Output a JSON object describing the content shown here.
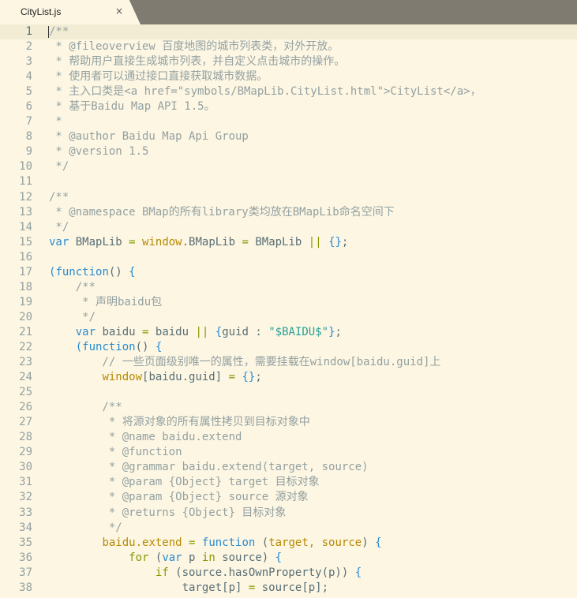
{
  "tab": {
    "title": "CityList.js",
    "close_glyph": "×"
  },
  "colors": {
    "background": "#fdf6e3",
    "comment": "#93a1a1",
    "keyword": "#268bd2",
    "global": "#b58900",
    "string": "#2aa198",
    "operator": "#859900",
    "text": "#586e75"
  },
  "editor": {
    "current_line": 1,
    "lines": [
      {
        "n": "1",
        "tokens": [
          {
            "t": "/**",
            "c": "comment"
          }
        ]
      },
      {
        "n": "2",
        "tokens": [
          {
            "t": " * @fileoverview 百度地图的城市列表类，对外开放。",
            "c": "comment"
          }
        ]
      },
      {
        "n": "3",
        "tokens": [
          {
            "t": " * 帮助用户直接生成城市列表，并自定义点击城市的操作。",
            "c": "comment"
          }
        ]
      },
      {
        "n": "4",
        "tokens": [
          {
            "t": " * 使用者可以通过接口直接获取城市数据。",
            "c": "comment"
          }
        ]
      },
      {
        "n": "5",
        "tokens": [
          {
            "t": " * 主入口类是<a href=\"symbols/BMapLib.CityList.html\">CityList</a>，",
            "c": "comment"
          }
        ]
      },
      {
        "n": "6",
        "tokens": [
          {
            "t": " * 基于Baidu Map API 1.5。",
            "c": "comment"
          }
        ]
      },
      {
        "n": "7",
        "tokens": [
          {
            "t": " *",
            "c": "comment"
          }
        ]
      },
      {
        "n": "8",
        "tokens": [
          {
            "t": " * @author Baidu Map Api Group",
            "c": "comment"
          }
        ]
      },
      {
        "n": "9",
        "tokens": [
          {
            "t": " * @version 1.5",
            "c": "comment"
          }
        ]
      },
      {
        "n": "10",
        "tokens": [
          {
            "t": " */",
            "c": "comment"
          }
        ]
      },
      {
        "n": "11",
        "tokens": []
      },
      {
        "n": "12",
        "tokens": [
          {
            "t": "/**",
            "c": "comment"
          }
        ]
      },
      {
        "n": "13",
        "tokens": [
          {
            "t": " * @namespace BMap的所有library类均放在BMapLib命名空间下",
            "c": "comment"
          }
        ]
      },
      {
        "n": "14",
        "tokens": [
          {
            "t": " */",
            "c": "comment"
          }
        ]
      },
      {
        "n": "15",
        "tokens": [
          {
            "t": "var",
            "c": "kw"
          },
          {
            "t": " BMapLib ",
            "c": "plain"
          },
          {
            "t": "=",
            "c": "op"
          },
          {
            "t": " ",
            "c": "plain"
          },
          {
            "t": "window",
            "c": "glob"
          },
          {
            "t": ".BMapLib ",
            "c": "plain"
          },
          {
            "t": "=",
            "c": "op"
          },
          {
            "t": " BMapLib ",
            "c": "plain"
          },
          {
            "t": "||",
            "c": "op"
          },
          {
            "t": " ",
            "c": "plain"
          },
          {
            "t": "{}",
            "c": "kw"
          },
          {
            "t": ";",
            "c": "plain"
          }
        ]
      },
      {
        "n": "16",
        "tokens": []
      },
      {
        "n": "17",
        "tokens": [
          {
            "t": "(",
            "c": "kw"
          },
          {
            "t": "function",
            "c": "kw"
          },
          {
            "t": "() ",
            "c": "plain"
          },
          {
            "t": "{",
            "c": "kw"
          }
        ]
      },
      {
        "n": "18",
        "tokens": [
          {
            "t": "    /**",
            "c": "comment"
          }
        ]
      },
      {
        "n": "19",
        "tokens": [
          {
            "t": "     * 声明baidu包",
            "c": "comment"
          }
        ]
      },
      {
        "n": "20",
        "tokens": [
          {
            "t": "     */",
            "c": "comment"
          }
        ]
      },
      {
        "n": "21",
        "tokens": [
          {
            "t": "    ",
            "c": "plain"
          },
          {
            "t": "var",
            "c": "kw"
          },
          {
            "t": " baidu ",
            "c": "plain"
          },
          {
            "t": "=",
            "c": "op"
          },
          {
            "t": " baidu ",
            "c": "plain"
          },
          {
            "t": "||",
            "c": "op"
          },
          {
            "t": " ",
            "c": "plain"
          },
          {
            "t": "{",
            "c": "kw"
          },
          {
            "t": "guid : ",
            "c": "plain"
          },
          {
            "t": "\"$BAIDU$\"",
            "c": "str"
          },
          {
            "t": "}",
            "c": "kw"
          },
          {
            "t": ";",
            "c": "plain"
          }
        ]
      },
      {
        "n": "22",
        "tokens": [
          {
            "t": "    ",
            "c": "plain"
          },
          {
            "t": "(",
            "c": "kw"
          },
          {
            "t": "function",
            "c": "kw"
          },
          {
            "t": "() ",
            "c": "plain"
          },
          {
            "t": "{",
            "c": "kw"
          }
        ]
      },
      {
        "n": "23",
        "tokens": [
          {
            "t": "        // 一些页面级别唯一的属性，需要挂载在window[baidu.guid]上",
            "c": "comment"
          }
        ]
      },
      {
        "n": "24",
        "tokens": [
          {
            "t": "        ",
            "c": "plain"
          },
          {
            "t": "window",
            "c": "glob"
          },
          {
            "t": "[baidu.guid] ",
            "c": "plain"
          },
          {
            "t": "=",
            "c": "op"
          },
          {
            "t": " ",
            "c": "plain"
          },
          {
            "t": "{}",
            "c": "kw"
          },
          {
            "t": ";",
            "c": "plain"
          }
        ]
      },
      {
        "n": "25",
        "tokens": []
      },
      {
        "n": "26",
        "tokens": [
          {
            "t": "        /**",
            "c": "comment"
          }
        ]
      },
      {
        "n": "27",
        "tokens": [
          {
            "t": "         * 将源对象的所有属性拷贝到目标对象中",
            "c": "comment"
          }
        ]
      },
      {
        "n": "28",
        "tokens": [
          {
            "t": "         * @name baidu.extend",
            "c": "comment"
          }
        ]
      },
      {
        "n": "29",
        "tokens": [
          {
            "t": "         * @function",
            "c": "comment"
          }
        ]
      },
      {
        "n": "30",
        "tokens": [
          {
            "t": "         * @grammar baidu.extend(target, source)",
            "c": "comment"
          }
        ]
      },
      {
        "n": "31",
        "tokens": [
          {
            "t": "         * @param {Object} target 目标对象",
            "c": "comment"
          }
        ]
      },
      {
        "n": "32",
        "tokens": [
          {
            "t": "         * @param {Object} source 源对象",
            "c": "comment"
          }
        ]
      },
      {
        "n": "33",
        "tokens": [
          {
            "t": "         * @returns {Object} 目标对象",
            "c": "comment"
          }
        ]
      },
      {
        "n": "34",
        "tokens": [
          {
            "t": "         */",
            "c": "comment"
          }
        ]
      },
      {
        "n": "35",
        "tokens": [
          {
            "t": "        ",
            "c": "plain"
          },
          {
            "t": "baidu.extend",
            "c": "glob"
          },
          {
            "t": " ",
            "c": "plain"
          },
          {
            "t": "=",
            "c": "op"
          },
          {
            "t": " ",
            "c": "plain"
          },
          {
            "t": "function",
            "c": "kw"
          },
          {
            "t": " (",
            "c": "plain"
          },
          {
            "t": "target, source",
            "c": "glob"
          },
          {
            "t": ") ",
            "c": "plain"
          },
          {
            "t": "{",
            "c": "kw"
          }
        ]
      },
      {
        "n": "36",
        "tokens": [
          {
            "t": "            ",
            "c": "plain"
          },
          {
            "t": "for",
            "c": "op"
          },
          {
            "t": " (",
            "c": "plain"
          },
          {
            "t": "var",
            "c": "kw"
          },
          {
            "t": " p ",
            "c": "plain"
          },
          {
            "t": "in",
            "c": "op"
          },
          {
            "t": " source) ",
            "c": "plain"
          },
          {
            "t": "{",
            "c": "kw"
          }
        ]
      },
      {
        "n": "37",
        "tokens": [
          {
            "t": "                ",
            "c": "plain"
          },
          {
            "t": "if",
            "c": "op"
          },
          {
            "t": " (source.hasOwnProperty(p)) ",
            "c": "plain"
          },
          {
            "t": "{",
            "c": "kw"
          }
        ]
      },
      {
        "n": "38",
        "tokens": [
          {
            "t": "                    target[p] ",
            "c": "plain"
          },
          {
            "t": "=",
            "c": "op"
          },
          {
            "t": " source[p];",
            "c": "plain"
          }
        ]
      }
    ]
  }
}
